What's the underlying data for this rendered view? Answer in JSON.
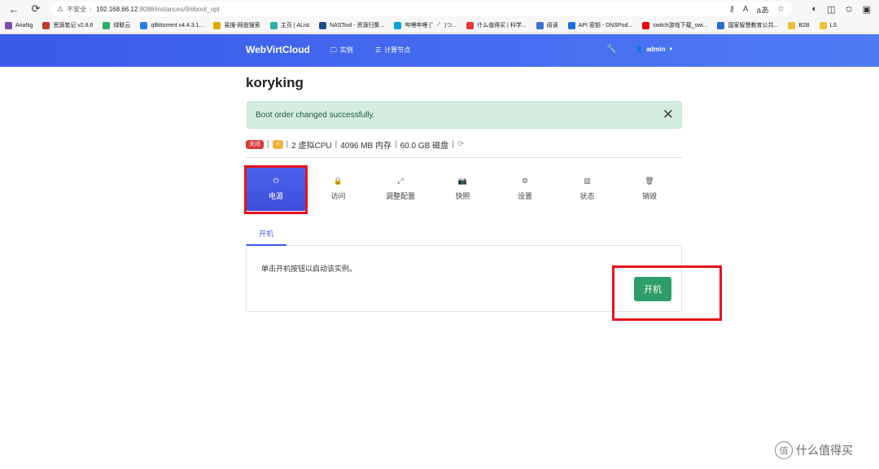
{
  "browser": {
    "security_label": "不安全",
    "url_host": "192.168.66.12",
    "url_path": ":8088/instances/9/#boot_opt",
    "read_aloud": "A",
    "translate": "aあ",
    "bookmarks": [
      {
        "label": "AriaNg",
        "color": "#7a4fb0"
      },
      {
        "label": "思源笔记 v2.8.6",
        "color": "#c0392b"
      },
      {
        "label": "绿联云",
        "color": "#27ae60"
      },
      {
        "label": "qBittorrent v4.4.3.1...",
        "color": "#2c7be5"
      },
      {
        "label": "易搜-网盘搜索",
        "color": "#e0a800"
      },
      {
        "label": "主页 | AList",
        "color": "#2bb0a6"
      },
      {
        "label": "NASTool - 资源归集...",
        "color": "#1a4c8c"
      },
      {
        "label": "哔哩哔哩 (゜-゜)つ...",
        "color": "#00a1d6"
      },
      {
        "label": "什么值得买 | 科学...",
        "color": "#e4393c"
      },
      {
        "label": "阅读",
        "color": "#3d6fd8"
      },
      {
        "label": "API 密钥 - DNSPod...",
        "color": "#1d6fe0"
      },
      {
        "label": "switch游戏下载_swi...",
        "color": "#e60012"
      },
      {
        "label": "国家智慧教育公共...",
        "color": "#2a6bd1"
      },
      {
        "label": "B2B",
        "color": "#f0c23a"
      },
      {
        "label": "LS",
        "color": "#f0c23a"
      }
    ]
  },
  "navbar": {
    "brand": "WebVirtCloud",
    "instances": "实例",
    "nodes": "计算节点",
    "user": "admin"
  },
  "instance": {
    "name": "koryking",
    "alert": "Boot order changed successfully.",
    "status_badge": "关闭",
    "flash_badge": "⚡",
    "vcpu": "2 虚拟CPU",
    "memory": "4096 MB 内存",
    "disk": "60.0 GB 磁盘"
  },
  "tabs": [
    {
      "label": "电源",
      "icon": "⏻"
    },
    {
      "label": "访问",
      "icon": "🔒"
    },
    {
      "label": "调整配置",
      "icon": "⤢"
    },
    {
      "label": "快照",
      "icon": "📷"
    },
    {
      "label": "设置",
      "icon": "⚙"
    },
    {
      "label": "状态",
      "icon": "▥"
    },
    {
      "label": "销毁",
      "icon": "🗑"
    }
  ],
  "power": {
    "subtab": "开机",
    "description": "单击开机按钮以启动该实例。",
    "start_button": "开机"
  },
  "watermark": {
    "logo": "值",
    "text": "什么值得买"
  }
}
